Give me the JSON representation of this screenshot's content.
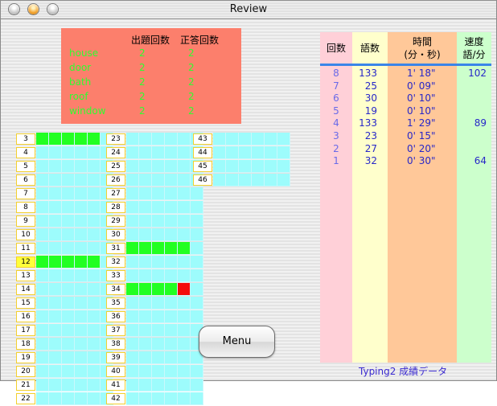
{
  "window": {
    "title": "Review"
  },
  "summary": {
    "headers": {
      "asked": "出題回数",
      "correct": "正答回数"
    },
    "rows": [
      {
        "word": "house",
        "asked": "2",
        "correct": "2"
      },
      {
        "word": "door",
        "asked": "2",
        "correct": "2"
      },
      {
        "word": "bath",
        "asked": "2",
        "correct": "2"
      },
      {
        "word": "roof",
        "asked": "2",
        "correct": "2"
      },
      {
        "word": "window",
        "asked": "2",
        "correct": "2"
      }
    ]
  },
  "grid": {
    "columns": [
      [
        {
          "n": "3",
          "green": 5
        },
        {
          "n": "4"
        },
        {
          "n": "5"
        },
        {
          "n": "6"
        },
        {
          "n": "7"
        },
        {
          "n": "8"
        },
        {
          "n": "9"
        },
        {
          "n": "10"
        },
        {
          "n": "11"
        },
        {
          "n": "12",
          "green": 5,
          "highlight": true
        },
        {
          "n": "13"
        },
        {
          "n": "14"
        },
        {
          "n": "15"
        },
        {
          "n": "16"
        },
        {
          "n": "17"
        },
        {
          "n": "18"
        },
        {
          "n": "19"
        },
        {
          "n": "20"
        },
        {
          "n": "21"
        },
        {
          "n": "22"
        }
      ],
      [
        {
          "n": "23"
        },
        {
          "n": "24"
        },
        {
          "n": "25"
        },
        {
          "n": "26"
        },
        {
          "n": "27"
        },
        {
          "n": "28"
        },
        {
          "n": "29"
        },
        {
          "n": "30"
        },
        {
          "n": "31",
          "green": 5
        },
        {
          "n": "32"
        },
        {
          "n": "33"
        },
        {
          "n": "34",
          "green": 4,
          "red": 1
        },
        {
          "n": "35"
        },
        {
          "n": "36"
        },
        {
          "n": "37"
        },
        {
          "n": "38"
        },
        {
          "n": "39"
        },
        {
          "n": "40"
        },
        {
          "n": "41"
        },
        {
          "n": "42"
        }
      ],
      [
        {
          "n": "43"
        },
        {
          "n": "44"
        },
        {
          "n": "45"
        },
        {
          "n": "46"
        }
      ]
    ],
    "colors": {
      "empty": "#9dfcfc",
      "correct": "#22ff22",
      "error": "#f40c0c"
    }
  },
  "menu": {
    "label": "Menu"
  },
  "table": {
    "headers": {
      "round": "回数",
      "words": "語数",
      "time_line1": "時間",
      "time_line2": "(分・秒)",
      "speed_line1": "速度",
      "speed_line2": "語/分"
    },
    "rows": [
      {
        "round": "8",
        "words": "133",
        "time": "1' 18\"",
        "speed": "102"
      },
      {
        "round": "7",
        "words": "25",
        "time": "0' 09\"",
        "speed": ""
      },
      {
        "round": "6",
        "words": "30",
        "time": "0' 10\"",
        "speed": ""
      },
      {
        "round": "5",
        "words": "19",
        "time": "0' 10\"",
        "speed": ""
      },
      {
        "round": "4",
        "words": "133",
        "time": "1' 29\"",
        "speed": "89"
      },
      {
        "round": "3",
        "words": "23",
        "time": "0' 15\"",
        "speed": ""
      },
      {
        "round": "2",
        "words": "27",
        "time": "0' 20\"",
        "speed": ""
      },
      {
        "round": "1",
        "words": "32",
        "time": "0' 30\"",
        "speed": "64"
      }
    ],
    "footer": "Typing2 成績データ"
  }
}
